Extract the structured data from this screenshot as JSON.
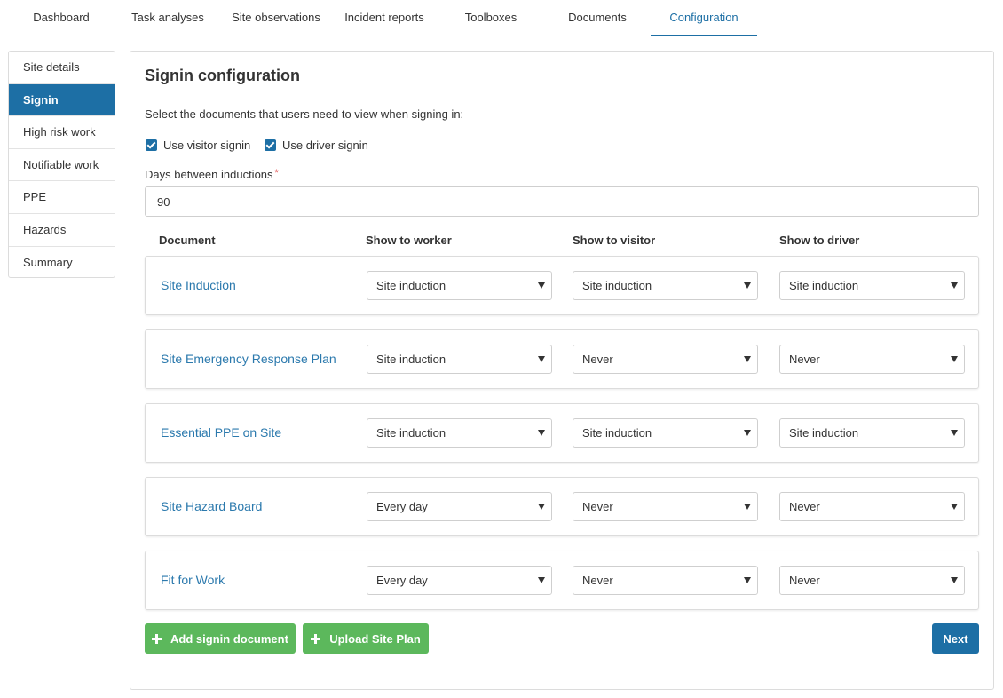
{
  "topnav": {
    "tabs": [
      {
        "label": "Dashboard"
      },
      {
        "label": "Task analyses"
      },
      {
        "label": "Site observations"
      },
      {
        "label": "Incident reports"
      },
      {
        "label": "Toolboxes"
      },
      {
        "label": "Documents"
      },
      {
        "label": "Configuration",
        "active": true
      }
    ]
  },
  "sidebar": {
    "items": [
      {
        "label": "Site details"
      },
      {
        "label": "Signin",
        "active": true
      },
      {
        "label": "High risk work"
      },
      {
        "label": "Notifiable work"
      },
      {
        "label": "PPE"
      },
      {
        "label": "Hazards"
      },
      {
        "label": "Summary"
      }
    ]
  },
  "main": {
    "title": "Signin configuration",
    "intro": "Select the documents that users need to view when signing in:",
    "checkboxes": {
      "visitor": {
        "label": "Use visitor signin",
        "checked": true
      },
      "driver": {
        "label": "Use driver signin",
        "checked": true
      }
    },
    "days": {
      "label": "Days between inductions",
      "required_mark": "*",
      "value": "90"
    },
    "columns": {
      "document": "Document",
      "worker": "Show to worker",
      "visitor": "Show to visitor",
      "driver": "Show to driver"
    },
    "rows": [
      {
        "name": "Site Induction",
        "worker": "Site induction",
        "visitor": "Site induction",
        "driver": "Site induction"
      },
      {
        "name": "Site Emergency Response Plan",
        "worker": "Site induction",
        "visitor": "Never",
        "driver": "Never"
      },
      {
        "name": "Essential PPE on Site",
        "worker": "Site induction",
        "visitor": "Site induction",
        "driver": "Site induction"
      },
      {
        "name": "Site Hazard Board",
        "worker": "Every day",
        "visitor": "Never",
        "driver": "Never"
      },
      {
        "name": "Fit for Work",
        "worker": "Every day",
        "visitor": "Never",
        "driver": "Never"
      }
    ],
    "buttons": {
      "add": "Add signin document",
      "upload": "Upload Site Plan",
      "next": "Next"
    }
  },
  "colors": {
    "primary": "#1d6fa5",
    "link": "#2b79ad",
    "success": "#5cb85c",
    "required": "#e04b4b"
  }
}
